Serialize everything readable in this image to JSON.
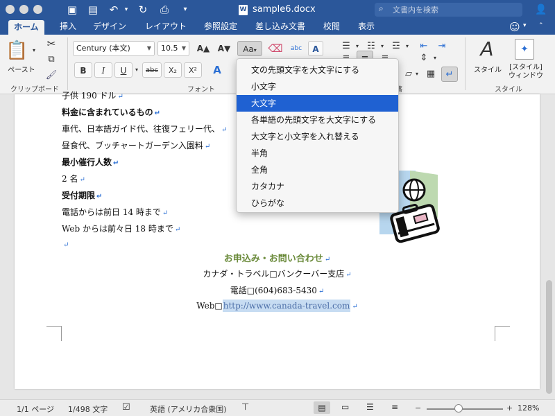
{
  "title_bar": {
    "doc_title": "sample6.docx",
    "doc_badge": "W",
    "search_placeholder": "文書内を検索"
  },
  "tabs": [
    {
      "label": "ホーム",
      "active": true
    },
    {
      "label": "挿入"
    },
    {
      "label": "デザイン"
    },
    {
      "label": "レイアウト"
    },
    {
      "label": "参照設定"
    },
    {
      "label": "差し込み文書"
    },
    {
      "label": "校閲"
    },
    {
      "label": "表示"
    }
  ],
  "ribbon": {
    "paste_label": "ペースト",
    "clipboard_group": "クリップボード",
    "font_name": "Century (本文)",
    "font_size": "10.5",
    "font_group": "フォント",
    "paragraph_group": "落",
    "style_label": "スタイル",
    "style_pane_label_1": "[スタイル]",
    "style_pane_label_2": "ウィンドウ",
    "style_group": "スタイル",
    "btn_bold": "B",
    "btn_italic": "I",
    "btn_underline": "U",
    "btn_strike": "abc",
    "btn_sub": "X₂",
    "btn_sup": "X²",
    "btn_grow": "A▲",
    "btn_shrink": "A▼",
    "btn_case": "Aa",
    "btn_abc": "abc",
    "btn_box": "A"
  },
  "document": {
    "lines": [
      {
        "text": "子供 190 ドル",
        "bold": false
      },
      {
        "text": "料金に含まれているもの",
        "bold": true
      },
      {
        "text": "車代、日本語ガイド代、往復フェリー代、",
        "bold": false
      },
      {
        "text": "昼食代、ブッチャートガーデン入園料",
        "bold": false
      },
      {
        "text": "最小催行人数",
        "bold": true
      },
      {
        "text": "2 名",
        "bold": false
      },
      {
        "text": "受付期限",
        "bold": true
      },
      {
        "text": "電話からは前日 14 時まで",
        "bold": false
      },
      {
        "text": "Web からは前々日 18 時まで",
        "bold": false
      }
    ],
    "contact_heading": "お申込み・お問い合わせ",
    "contact_company": "カナダ・トラベル□バンクーバー支店",
    "contact_phone": "電話□(604)683-5430",
    "contact_web_label": "Web□",
    "contact_url": "http://www.canada-travel.com",
    "para_mark": "↵"
  },
  "case_menu": {
    "items": [
      "文の先頭文字を大文字にする",
      "小文字",
      "大文字",
      "各単語の先頭文字を大文字にする",
      "大文字と小文字を入れ替える",
      "半角",
      "全角",
      "カタカナ",
      "ひらがな"
    ],
    "selected_index": 2
  },
  "status_bar": {
    "page": "1/1 ページ",
    "words": "1/498 文字",
    "language": "英語 (アメリカ合衆国)",
    "zoom": "128%",
    "zoom_fraction": 0.42
  },
  "colors": {
    "brand_blue": "#2b579a",
    "menu_selected": "#1f61d2",
    "heading_green": "#6a8a3a"
  }
}
